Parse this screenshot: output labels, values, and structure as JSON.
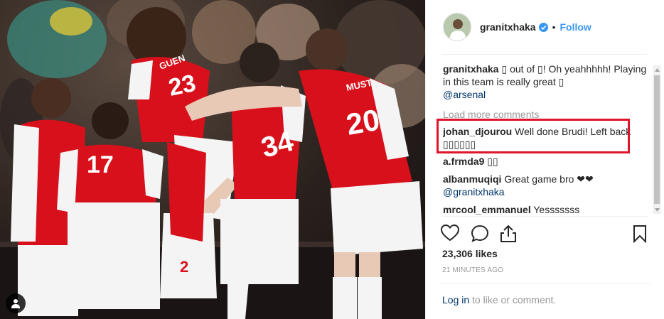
{
  "post": {
    "author": "granitxhaka",
    "follow_label": "Follow",
    "likes": "23,306 likes",
    "timestamp": "21 MINUTES AGO"
  },
  "caption": {
    "user": "granitxhaka",
    "text": "▯ out of ▯! Oh yeahhhhh! Playing in this team is really great ▯",
    "mention": "@arsenal"
  },
  "load_more_label": "Load more comments",
  "comments": [
    {
      "user": "johan_djourou",
      "text": "Well done Brudi! Left back ▯▯▯▯▯▯"
    },
    {
      "user": "a.frmda9",
      "text": "▯▯"
    },
    {
      "user": "albanmuqiqi",
      "text": "Great game bro ❤❤",
      "mention": "@granitxhaka"
    },
    {
      "user": "mrcool_emmanuel",
      "text": "Yesssssss"
    }
  ],
  "photo": {
    "jersey_numbers": [
      "17",
      "23",
      "34",
      "20",
      "2"
    ],
    "jersey_names": [
      "GUEN",
      "MUST"
    ]
  },
  "footer": {
    "login_link": "Log in",
    "login_rest": "to like or comment."
  },
  "colors": {
    "arsenal_red": "#d8101c",
    "highlight": "#e0142a",
    "link_blue": "#3897f0"
  }
}
